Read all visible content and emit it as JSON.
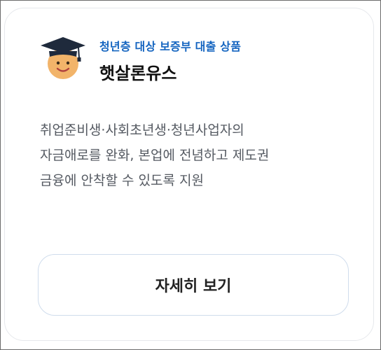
{
  "card": {
    "mascot_icon": "graduate-mascot-icon",
    "subtitle": "청년층 대상 보증부 대출 상품",
    "title": "햇살론유스",
    "description_lines": [
      "취업준비생·사회초년생·청년사업자의",
      "자금애로를 완화, 본업에 전념하고 제도권",
      "금융에 안착할 수 있도록 지원"
    ],
    "button_label": "자세히 보기"
  },
  "colors": {
    "subtitle": "#1565c0",
    "face": "#f2b46a",
    "cap": "#1f2a3c"
  }
}
